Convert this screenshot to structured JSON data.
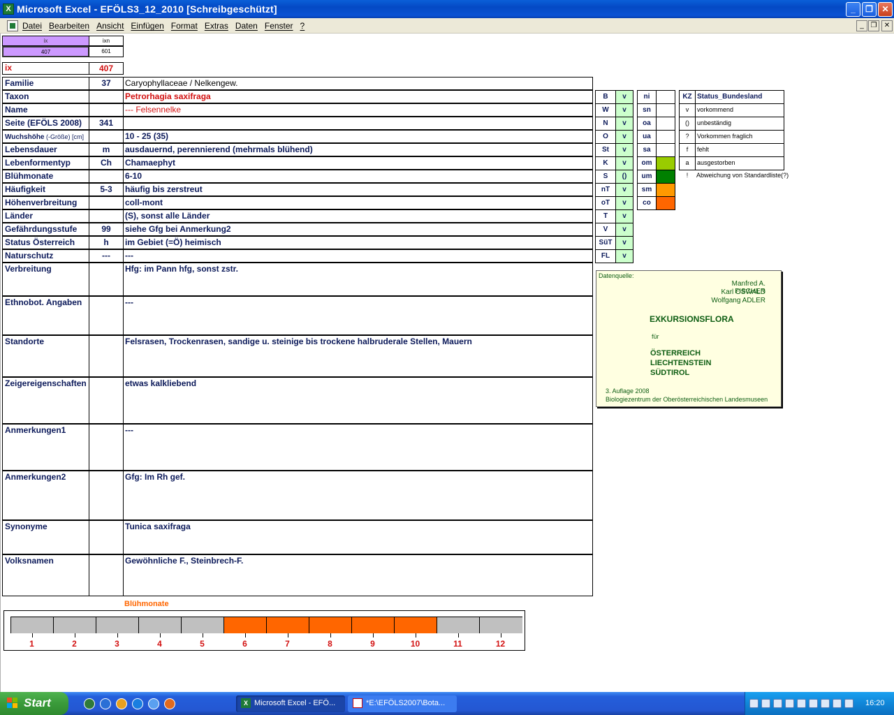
{
  "window": {
    "title": "Microsoft Excel - EFÖLS3_12_2010  [Schreibgeschützt]",
    "app_icon": "excel-icon",
    "buttons": {
      "minimize": "_",
      "restore": "❐",
      "close": "✕"
    }
  },
  "menu": {
    "items": [
      "Datei",
      "Bearbeiten",
      "Ansicht",
      "Einfügen",
      "Format",
      "Extras",
      "Daten",
      "Fenster",
      "?"
    ],
    "doc_buttons": {
      "minimize": "_",
      "restore": "❐",
      "close": "✕"
    }
  },
  "index_box": {
    "col1_header": "ix",
    "col2_header": "ixn",
    "col1_value": "407",
    "col2_value": "601",
    "ix_label": "ix",
    "ix_value": "407"
  },
  "rows": [
    {
      "label": "Familie",
      "num": "37",
      "value": "Caryophyllaceae  /  Nelkengew."
    },
    {
      "label": "Taxon",
      "num": "",
      "value": "Petrorhagia saxifraga"
    },
    {
      "label": "Name",
      "num": "",
      "value": "--- Felsennelke"
    },
    {
      "label": "Seite (EFÖLS 2008)",
      "num": "341",
      "value": ""
    },
    {
      "label": "Wuchshöhe",
      "label_suffix": " (-Größe) [cm]",
      "num": "",
      "value": " 10 - 25 (35)"
    },
    {
      "label": "Lebensdauer",
      "num": "m",
      "value": "ausdauernd, perennierend (mehrmals blühend)"
    },
    {
      "label": "Lebenformentyp",
      "num": "Ch",
      "value": "Chamaephyt"
    },
    {
      "label": "Blühmonate",
      "num": "",
      "value": " 6-10"
    },
    {
      "label": "Häufigkeit",
      "num": "5-3",
      "value": "häufig bis zerstreut"
    },
    {
      "label": "Höhenverbreitung",
      "num": "",
      "value": "coll-mont"
    },
    {
      "label": "Länder",
      "num": "",
      "value": "(S), sonst alle Länder"
    },
    {
      "label": "Gefährdungsstufe",
      "num": "99",
      "value": "siehe Gfg bei Anmerkung2"
    },
    {
      "label": "Status Österreich",
      "num": "h",
      "value": "im Gebiet (=Ö) heimisch"
    },
    {
      "label": "Naturschutz",
      "num": "---",
      "value": " ---"
    },
    {
      "label": "Verbreitung",
      "num": "",
      "value": "Hfg: im Pann hfg, sonst zstr."
    },
    {
      "label": "Ethnobot. Angaben",
      "num": "",
      "value": "---"
    },
    {
      "label": "Standorte",
      "num": "",
      "value": "Felsrasen, Trockenrasen, sandige u. steinige bis trockene halbruderale Stellen, Mauern"
    },
    {
      "label": "Zeigereigenschaften",
      "num": "",
      "value": "etwas kalkliebend"
    },
    {
      "label": "Anmerkungen1",
      "num": "",
      "value": "---"
    },
    {
      "label": "Anmerkungen2",
      "num": "",
      "value": "Gfg: Im Rh gef."
    },
    {
      "label": "Synonyme",
      "num": "",
      "value": "Tunica saxifraga"
    },
    {
      "label": "Volksnamen",
      "num": "",
      "value": "Gewöhnliche F., Steinbrech-F."
    }
  ],
  "states": [
    {
      "code": "B",
      "val": "v"
    },
    {
      "code": "W",
      "val": "v"
    },
    {
      "code": "N",
      "val": "v"
    },
    {
      "code": "O",
      "val": "v"
    },
    {
      "code": "St",
      "val": "v"
    },
    {
      "code": "K",
      "val": "v"
    },
    {
      "code": "S",
      "val": "()"
    },
    {
      "code": "nT",
      "val": "v"
    },
    {
      "code": "oT",
      "val": "v"
    },
    {
      "code": "T",
      "val": "v"
    },
    {
      "code": "V",
      "val": "v"
    },
    {
      "code": "SüT",
      "val": "v"
    },
    {
      "code": "FL",
      "val": "v"
    }
  ],
  "altitudes": [
    {
      "code": "ni",
      "color": ""
    },
    {
      "code": "sn",
      "color": ""
    },
    {
      "code": "oa",
      "color": ""
    },
    {
      "code": "ua",
      "color": ""
    },
    {
      "code": "sa",
      "color": ""
    },
    {
      "code": "om",
      "color": "#99cc00"
    },
    {
      "code": "um",
      "color": "#008000"
    },
    {
      "code": "sm",
      "color": "#ff9900"
    },
    {
      "code": "co",
      "color": "#ff6600"
    }
  ],
  "status_legend": {
    "header_kz": "KZ",
    "header_label": "Status_Bundesland",
    "items": [
      {
        "kz": "v",
        "label": "vorkommend"
      },
      {
        "kz": "()",
        "label": "unbeständig"
      },
      {
        "kz": "?",
        "label": "Vorkommen fraglich"
      },
      {
        "kz": "f",
        "label": "fehlt"
      },
      {
        "kz": "a",
        "label": "ausgestorben"
      },
      {
        "kz": "!",
        "label": "Abweichung von Standardliste(?)"
      }
    ]
  },
  "source": {
    "heading": "Datenquelle:",
    "authors": [
      "Manfred A. FISCHER",
      "Karl OSWALD",
      "Wolfgang ADLER"
    ],
    "book_title": "EXKURSIONSFLORA",
    "fuer": "für",
    "countries": [
      "ÖSTERREICH",
      "LIECHTENSTEIN",
      "SÜDTIROL"
    ],
    "edition": "3. Auflage 2008",
    "publisher": "Biologiezentrum der Oberösterreichischen Landesmuseen"
  },
  "bloom_chart": {
    "title": "Blühmonate",
    "months": [
      "1",
      "2",
      "3",
      "4",
      "5",
      "6",
      "7",
      "8",
      "9",
      "10",
      "11",
      "12"
    ],
    "flowering": [
      false,
      false,
      false,
      false,
      false,
      true,
      true,
      true,
      true,
      true,
      false,
      false
    ],
    "colors": {
      "on": "#ff6600",
      "off": "#c0c0c0"
    }
  },
  "taskbar": {
    "start_label": "Start",
    "quicklaunch": [
      "excel-icon",
      "outlook-icon",
      "media-player-icon",
      "ie-icon",
      "messenger-icon",
      "firefox-icon"
    ],
    "tasks": [
      {
        "label": "Microsoft Excel - EFÖ...",
        "icon": "excel-icon",
        "active": true
      },
      {
        "label": "*E:\\EFÖLS2007\\Bota...",
        "icon": "editor-icon",
        "active": false
      }
    ],
    "clock": "16:20"
  }
}
